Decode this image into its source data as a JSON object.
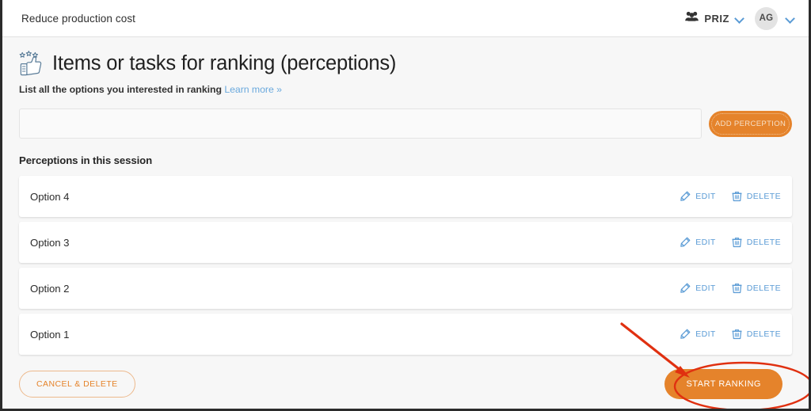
{
  "window": {
    "topbar": {
      "project_title": "Reduce production cost",
      "org_name": "PRIZ",
      "org_icon": "group-people-icon",
      "org_chevron": "chevron-down-icon",
      "avatar_initials": "AG",
      "avatar_chevron": "chevron-down-icon"
    }
  },
  "page": {
    "icon": "thumbs-up-stars-icon",
    "title": "Items or tasks for ranking (perceptions)",
    "subtitle_text": "List all the options you interested in ranking",
    "subtitle_link": "Learn more »"
  },
  "add_row": {
    "input_value": "",
    "input_placeholder": "",
    "add_button_label": "ADD PERCEPTION"
  },
  "list": {
    "section_label": "Perceptions in this session",
    "edit_label": "EDIT",
    "delete_label": "DELETE",
    "edit_icon": "pencil-icon",
    "delete_icon": "trash-icon",
    "items": [
      {
        "label": "Option 4"
      },
      {
        "label": "Option 3"
      },
      {
        "label": "Option 2"
      },
      {
        "label": "Option 1"
      }
    ]
  },
  "footer": {
    "cancel_label": "CANCEL & DELETE",
    "start_label": "START RANKING"
  },
  "annotation": {
    "shape": "red-ellipse-with-arrow",
    "color": "#e03010",
    "target": "start-ranking-button"
  },
  "colors": {
    "accent_orange": "#e5832b",
    "link_blue": "#5a9bd5",
    "page_background": "#f7f7f7",
    "card_white": "#ffffff",
    "annotation_red": "#e03010"
  }
}
